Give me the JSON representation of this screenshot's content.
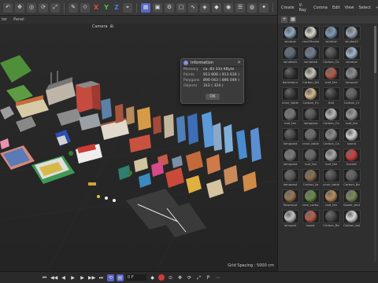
{
  "viewport": {
    "menu": [
      "ter",
      "Panel"
    ],
    "camera": "Camera",
    "grid_spacing": "Grid Spacing : 5000 cm"
  },
  "info": {
    "title": "Information",
    "rows": [
      {
        "k": "Memory",
        "v": "ca. 83 333 KByte"
      },
      {
        "k": "Points",
        "v": "913 606 ( 913 616 )"
      },
      {
        "k": "Polygons",
        "v": "890 043 ( 890 049 )"
      },
      {
        "k": "Objects",
        "v": "312 ( 324 )"
      }
    ],
    "ok": "OK"
  },
  "panel": {
    "tabs": [
      "Create",
      "V-Ray",
      "Corona",
      "Edit",
      "View",
      "Select",
      "»"
    ],
    "materials": [
      {
        "label": "window",
        "color": "#8fa9c4"
      },
      {
        "label": "courtHouse",
        "color": "#d8d4c8"
      },
      {
        "label": "window",
        "color": "#7c9ab8"
      },
      {
        "label": "window2",
        "color": "#9aa7b6"
      },
      {
        "label": "window5",
        "color": "#5f6b7a"
      },
      {
        "label": "window8",
        "color": "#6d7e92"
      },
      {
        "label": "Carbon_Ce",
        "color": "#4a4a4a"
      },
      {
        "label": "window",
        "color": "#9cb4cf"
      },
      {
        "label": "barnabour",
        "color": "#3a3a3a"
      },
      {
        "label": "Carbon_tat",
        "color": "#c9c4b8"
      },
      {
        "label": "roof_fen",
        "color": "#b65a4a"
      },
      {
        "label": "lampost",
        "color": "#8c8c8c"
      },
      {
        "label": "chair_table",
        "color": "#3c3c3c"
      },
      {
        "label": "Carbon_Fu",
        "color": "#d2b88a"
      },
      {
        "label": "flad",
        "color": "#3e3e3e"
      },
      {
        "label": "Carbon_Cr",
        "color": "#606060"
      },
      {
        "label": "roof_fen",
        "color": "#777777"
      },
      {
        "label": "lamppost",
        "color": "#555555"
      },
      {
        "label": "Carbon_Ca",
        "color": "#b8b8b8"
      },
      {
        "label": "roof_fen",
        "color": "#9a9a9a"
      },
      {
        "label": "lamppost",
        "color": "#4a4a4a"
      },
      {
        "label": "chair_table",
        "color": "#6b6b6b"
      },
      {
        "label": "Carbon_Ca",
        "color": "#8a8a8a"
      },
      {
        "label": "sosna",
        "color": "#cfcfcf"
      },
      {
        "label": "lamppost",
        "color": "#7a7a7a"
      },
      {
        "label": "roof_fen",
        "color": "#666666"
      },
      {
        "label": "roof_fen",
        "color": "#a8a8a8"
      },
      {
        "label": "bucket",
        "color": "#d43a3a"
      },
      {
        "label": "lamppost",
        "color": "#5a5a5a"
      },
      {
        "label": "Carbon_ta",
        "color": "#8a6f4c"
      },
      {
        "label": "chair_table",
        "color": "#4c4c4c"
      },
      {
        "label": "Carbon_Ba",
        "color": "#5e5e5e"
      },
      {
        "label": "flowerpot",
        "color": "#9a7650"
      },
      {
        "label": "tree_carbo",
        "color": "#6a8c44"
      },
      {
        "label": "roof_fen",
        "color": "#b98d5a"
      },
      {
        "label": "flower_bed",
        "color": "#7b8a5a"
      },
      {
        "label": "lampost",
        "color": "#c0c0c0"
      },
      {
        "label": "boost",
        "color": "#b85c4a"
      },
      {
        "label": "Carbon_Ba",
        "color": "#4a4a4a"
      },
      {
        "label": "Carbon_bal",
        "color": "#d8d8d8"
      }
    ]
  },
  "timeline": {
    "frame": "0 F"
  },
  "colors": {
    "accent": "#5865c8",
    "record": "#d43b3b"
  }
}
